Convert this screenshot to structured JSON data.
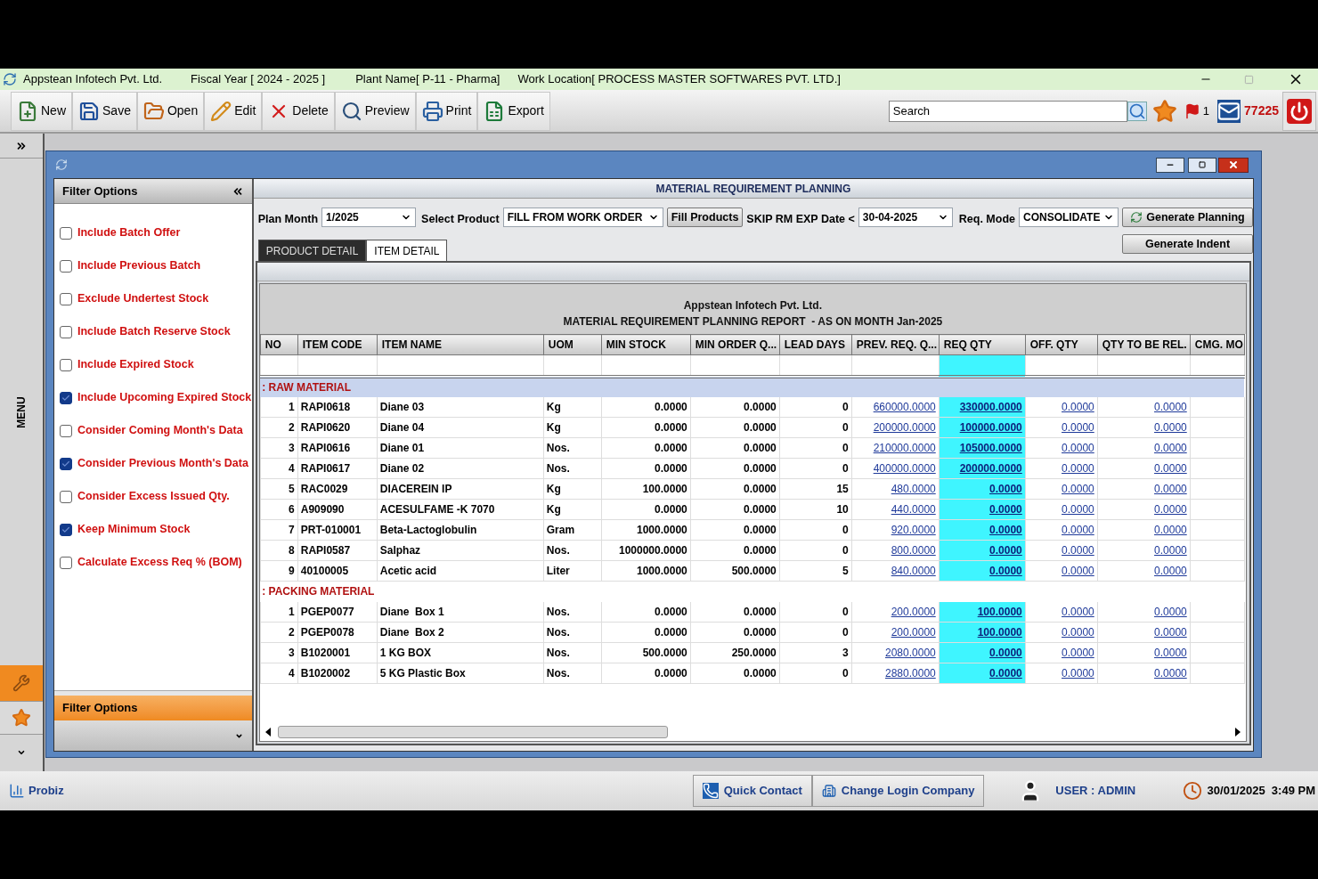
{
  "title_bar": {
    "company": "Appstean Infotech Pvt. Ltd.",
    "fiscal_year": "Fiscal Year [ 2024  -  2025 ]",
    "plant": "Plant Name[ P-11  - Pharma]",
    "work_location": "Work Location[ PROCESS MASTER SOFTWARES PVT. LTD.]"
  },
  "toolbar": [
    {
      "kind": "new",
      "label": "New"
    },
    {
      "kind": "save",
      "label": "Save"
    },
    {
      "kind": "open",
      "label": "Open"
    },
    {
      "kind": "edit",
      "label": "Edit"
    },
    {
      "kind": "delete",
      "label": "Delete"
    },
    {
      "kind": "preview",
      "label": "Preview"
    },
    {
      "kind": "print",
      "label": "Print"
    },
    {
      "kind": "export",
      "label": "Export"
    }
  ],
  "search": {
    "placeholder": "Search"
  },
  "flag_count": "1",
  "mail_count": "77225",
  "side_menu": {
    "label": "MENU"
  },
  "filter_panel": {
    "title": "Filter Options",
    "options": [
      {
        "label": "Include Batch Offer",
        "checked": false
      },
      {
        "label": "Include Previous Batch",
        "checked": false
      },
      {
        "label": "Exclude Undertest Stock",
        "checked": false
      },
      {
        "label": "Include Batch Reserve Stock",
        "checked": false
      },
      {
        "label": "Include Expired Stock",
        "checked": false
      },
      {
        "label": "Include Upcoming Expired Stock",
        "checked": true
      },
      {
        "label": "Consider Coming Month's Data",
        "checked": false
      },
      {
        "label": "Consider Previous Month's Data",
        "checked": true
      },
      {
        "label": "Consider Excess Issued Qty.",
        "checked": false
      },
      {
        "label": "Keep Minimum Stock",
        "checked": true
      },
      {
        "label": "Calculate Excess Req % (BOM)",
        "checked": false
      }
    ],
    "footer_title": "Filter Options"
  },
  "form": {
    "title": "MATERIAL REQUIREMENT PLANNING",
    "plan_month": {
      "label": "Plan Month",
      "value": "1/2025"
    },
    "select_product": {
      "label": "Select Product",
      "value": "FILL FROM WORK ORDER"
    },
    "fill_products": "Fill Products",
    "skip_date": {
      "label": "SKIP RM EXP Date <",
      "value": "30-04-2025"
    },
    "req_mode": {
      "label": "Req. Mode",
      "value": "CONSOLIDATE"
    },
    "generate_planning": "Generate Planning",
    "generate_indent": "Generate Indent"
  },
  "tabs": [
    {
      "label": "PRODUCT DETAIL",
      "selected": false
    },
    {
      "label": "ITEM DETAIL",
      "selected": true
    }
  ],
  "report": {
    "company": "Appstean Infotech Pvt. Ltd.",
    "title": "MATERIAL REQUIREMENT PLANNING REPORT  - AS ON MONTH Jan-2025",
    "columns": [
      "NO",
      "ITEM CODE",
      "ITEM NAME",
      "UOM",
      "MIN STOCK",
      "MIN ORDER Q...",
      "LEAD DAYS",
      "PREV. REQ. Q...",
      "REQ QTY",
      "OFF. QTY",
      "QTY TO BE REL.",
      "CMG. MO"
    ],
    "groups": [
      {
        "name": ": RAW MATERIAL",
        "rows": [
          {
            "no": "1",
            "code": "RAPI0618",
            "name": "Diane 03",
            "uom": "Kg",
            "min_stock": "0.0000",
            "min_order_qty": "0.0000",
            "lead_days": "0",
            "prev_req_qty": "660000.0000",
            "req_qty": "330000.0000",
            "off_qty": "0.0000",
            "qty_to_be_rel": "0.0000"
          },
          {
            "no": "2",
            "code": "RAPI0620",
            "name": "Diane 04",
            "uom": "Kg",
            "min_stock": "0.0000",
            "min_order_qty": "0.0000",
            "lead_days": "0",
            "prev_req_qty": "200000.0000",
            "req_qty": "100000.0000",
            "off_qty": "0.0000",
            "qty_to_be_rel": "0.0000"
          },
          {
            "no": "3",
            "code": "RAPI0616",
            "name": "Diane 01",
            "uom": "Nos.",
            "min_stock": "0.0000",
            "min_order_qty": "0.0000",
            "lead_days": "0",
            "prev_req_qty": "210000.0000",
            "req_qty": "105000.0000",
            "off_qty": "0.0000",
            "qty_to_be_rel": "0.0000"
          },
          {
            "no": "4",
            "code": "RAPI0617",
            "name": "Diane 02",
            "uom": "Nos.",
            "min_stock": "0.0000",
            "min_order_qty": "0.0000",
            "lead_days": "0",
            "prev_req_qty": "400000.0000",
            "req_qty": "200000.0000",
            "off_qty": "0.0000",
            "qty_to_be_rel": "0.0000"
          },
          {
            "no": "5",
            "code": "RAC0029",
            "name": "DIACEREIN IP",
            "uom": "Kg",
            "min_stock": "100.0000",
            "min_order_qty": "0.0000",
            "lead_days": "15",
            "prev_req_qty": "480.0000",
            "req_qty": "0.0000",
            "off_qty": "0.0000",
            "qty_to_be_rel": "0.0000"
          },
          {
            "no": "6",
            "code": "A909090",
            "name": "ACESULFAME -K 7070",
            "uom": "Kg",
            "min_stock": "0.0000",
            "min_order_qty": "0.0000",
            "lead_days": "10",
            "prev_req_qty": "440.0000",
            "req_qty": "0.0000",
            "off_qty": "0.0000",
            "qty_to_be_rel": "0.0000"
          },
          {
            "no": "7",
            "code": "PRT-010001",
            "name": "Beta-Lactoglobulin",
            "uom": "Gram",
            "min_stock": "1000.0000",
            "min_order_qty": "0.0000",
            "lead_days": "0",
            "prev_req_qty": "920.0000",
            "req_qty": "0.0000",
            "off_qty": "0.0000",
            "qty_to_be_rel": "0.0000"
          },
          {
            "no": "8",
            "code": "RAPI0587",
            "name": "Salphaz",
            "uom": "Nos.",
            "min_stock": "1000000.0000",
            "min_order_qty": "0.0000",
            "lead_days": "0",
            "prev_req_qty": "800.0000",
            "req_qty": "0.0000",
            "off_qty": "0.0000",
            "qty_to_be_rel": "0.0000"
          },
          {
            "no": "9",
            "code": "40100005",
            "name": "Acetic acid",
            "uom": "Liter",
            "min_stock": "1000.0000",
            "min_order_qty": "500.0000",
            "lead_days": "5",
            "prev_req_qty": "840.0000",
            "req_qty": "0.0000",
            "off_qty": "0.0000",
            "qty_to_be_rel": "0.0000"
          }
        ]
      },
      {
        "name": ": PACKING MATERIAL",
        "rows": [
          {
            "no": "1",
            "code": "PGEP0077",
            "name": "Diane  Box 1",
            "uom": "Nos.",
            "min_stock": "0.0000",
            "min_order_qty": "0.0000",
            "lead_days": "0",
            "prev_req_qty": "200.0000",
            "req_qty": "100.0000",
            "off_qty": "0.0000",
            "qty_to_be_rel": "0.0000"
          },
          {
            "no": "2",
            "code": "PGEP0078",
            "name": "Diane  Box 2",
            "uom": "Nos.",
            "min_stock": "0.0000",
            "min_order_qty": "0.0000",
            "lead_days": "0",
            "prev_req_qty": "200.0000",
            "req_qty": "100.0000",
            "off_qty": "0.0000",
            "qty_to_be_rel": "0.0000"
          },
          {
            "no": "3",
            "code": "B1020001",
            "name": "1 KG BOX",
            "uom": "Nos.",
            "min_stock": "500.0000",
            "min_order_qty": "250.0000",
            "lead_days": "3",
            "prev_req_qty": "2080.0000",
            "req_qty": "0.0000",
            "off_qty": "0.0000",
            "qty_to_be_rel": "0.0000"
          },
          {
            "no": "4",
            "code": "B1020002",
            "name": "5 KG Plastic Box",
            "uom": "Nos.",
            "min_stock": "0.0000",
            "min_order_qty": "0.0000",
            "lead_days": "0",
            "prev_req_qty": "2880.0000",
            "req_qty": "0.0000",
            "off_qty": "0.0000",
            "qty_to_be_rel": "0.0000"
          }
        ]
      }
    ]
  },
  "status_bar": {
    "app": "Probiz",
    "buttons": [
      "Quick Contact",
      "Change Login Company"
    ],
    "user": "USER : ADMIN",
    "datetime": "30/01/2025  3:49 PM"
  }
}
